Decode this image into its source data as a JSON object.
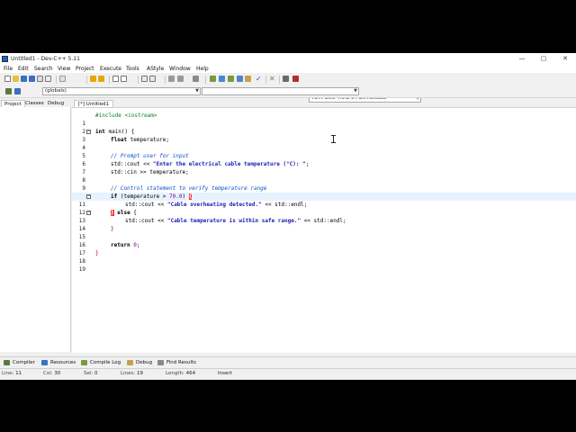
{
  "window": {
    "title": "Untitled1 - Dev-C++ 5.11",
    "minimize": "—",
    "maximize": "▢",
    "close": "✕"
  },
  "menu": [
    "File",
    "Edit",
    "Search",
    "View",
    "Project",
    "Execute",
    "Tools",
    "AStyle",
    "Window",
    "Help"
  ],
  "toolbar": {
    "compiler_select": "TDM-GCC 4.9.2 64-bit Release",
    "scope_select": "(globals)"
  },
  "left_panel": {
    "tabs": [
      "Project",
      "Classes",
      "Debug"
    ]
  },
  "editor": {
    "tab_label": "[*] Untitled1",
    "current_line": 11
  },
  "code_lines": [
    "1",
    "2",
    "3",
    "4",
    "5",
    "6",
    "7",
    "8",
    "9",
    "10",
    "11",
    "12",
    "13",
    "14",
    "15",
    "16",
    "17",
    "18",
    "19"
  ],
  "code": {
    "l1": "#include <iostream>",
    "l3_kw": "int",
    "l3_rest": " main() {",
    "l4_kw": "float",
    "l4_rest": " temperature;",
    "l6": "// Prompt user for input",
    "l7_a": "std::cout << ",
    "l7_str": "\"Enter the electrical cable temperature (°C): \"",
    "l7_b": ";",
    "l8": "std::cin >> temperature;",
    "l10": "// Control statement to verify temperature range",
    "l11_kw": "if",
    "l11_a": " (temperature > ",
    "l11_num": "70.0",
    "l11_b": ") ",
    "l11_brace": "{",
    "l12_a": "std::cout << ",
    "l12_str": "\"Cable overheating detected.\"",
    "l12_b": " << std::endl;",
    "l13_brace": "}",
    "l13_kw": " else",
    "l13_b": " {",
    "l14_a": "std::cout << ",
    "l14_str": "\"Cable temperature is within safe range.\"",
    "l14_b": " << std::endl;",
    "l15": "}",
    "l17_kw": "return",
    "l17_num": " 0",
    "l17_b": ";",
    "l18": "}"
  },
  "bottom_tabs": [
    "Compiler",
    "Resources",
    "Compile Log",
    "Debug",
    "Find Results"
  ],
  "status": {
    "line_label": "Line:",
    "line_value": "11",
    "col_label": "Col:",
    "col_value": "30",
    "sel_label": "Sel:",
    "sel_value": "0",
    "lines_label": "Lines:",
    "lines_value": "19",
    "length_label": "Length:",
    "length_value": "464",
    "mode": "Insert"
  },
  "colors": {
    "current_line_bg": "#e6f3ff",
    "brace_highlight": "#ff3030",
    "comment": "#0a52c9",
    "string": "#1b1bb0",
    "preprocessor": "#0a7a2f"
  }
}
